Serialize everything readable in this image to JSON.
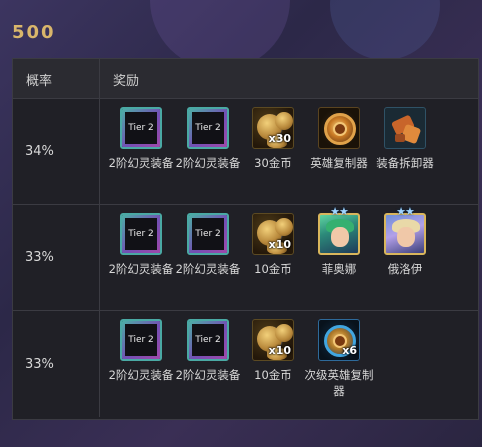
{
  "title": "500",
  "header": {
    "col1": "概率",
    "col2": "奖励"
  },
  "rows": [
    {
      "probability": "34%",
      "rewards": [
        {
          "icon": "tier-2-icon",
          "icon_text": "Tier 2",
          "label": "2阶幻灵装备"
        },
        {
          "icon": "tier-2-icon",
          "icon_text": "Tier 2",
          "label": "2阶幻灵装备"
        },
        {
          "icon": "gold-coins-icon",
          "qty": "x30",
          "label": "30金币"
        },
        {
          "icon": "hero-duplicator-icon",
          "label": "英雄复制器"
        },
        {
          "icon": "item-remover-icon",
          "label": "装备拆卸器"
        }
      ]
    },
    {
      "probability": "33%",
      "rewards": [
        {
          "icon": "tier-2-icon",
          "icon_text": "Tier 2",
          "label": "2阶幻灵装备"
        },
        {
          "icon": "tier-2-icon",
          "icon_text": "Tier 2",
          "label": "2阶幻灵装备"
        },
        {
          "icon": "gold-coins-icon",
          "qty": "x10",
          "label": "10金币"
        },
        {
          "icon": "champion-zeri-icon",
          "stars": "★★",
          "label": "菲奥娜"
        },
        {
          "icon": "champion-orianna-icon",
          "stars": "★★",
          "label": "俄洛伊"
        }
      ]
    },
    {
      "probability": "33%",
      "rewards": [
        {
          "icon": "tier-2-icon",
          "icon_text": "Tier 2",
          "label": "2阶幻灵装备"
        },
        {
          "icon": "tier-2-icon",
          "icon_text": "Tier 2",
          "label": "2阶幻灵装备"
        },
        {
          "icon": "gold-coins-icon",
          "qty": "x10",
          "label": "10金币"
        },
        {
          "icon": "lesser-hero-duplicator-icon",
          "qty": "x6",
          "label": "次级英雄复制器"
        }
      ]
    }
  ]
}
